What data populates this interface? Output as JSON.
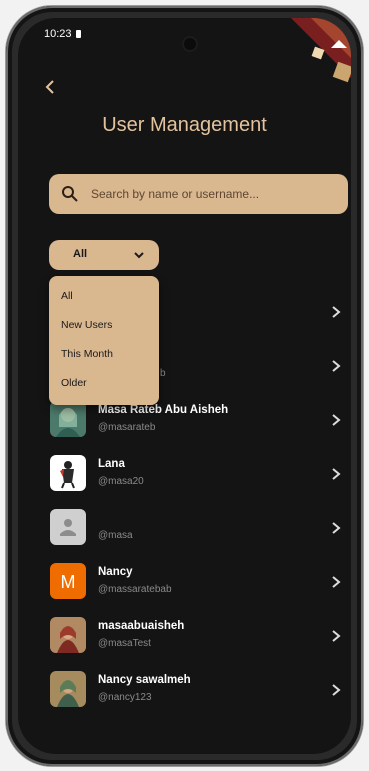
{
  "status_bar": {
    "time": "10:23"
  },
  "header": {
    "title": "User Management"
  },
  "search": {
    "placeholder": "Search by name or username..."
  },
  "filter": {
    "selected": "All",
    "options": [
      "All",
      "New Users",
      "This Month",
      "Older"
    ]
  },
  "users": [
    {
      "name": "",
      "handle": "",
      "avatar": "hidden"
    },
    {
      "name": "",
      "handle": "@masaratebab",
      "handle_visible": "b",
      "avatar": "hidden"
    },
    {
      "name": "Masa Rateb Abu Aisheh",
      "handle": "@masarateb",
      "avatar": "photo-green"
    },
    {
      "name": "Lana",
      "handle": "@masa20",
      "avatar": "photo-figure"
    },
    {
      "name": "",
      "handle": "@masa",
      "avatar": "placeholder"
    },
    {
      "name": "Nancy",
      "handle": "@massaratebab",
      "avatar": "letter-M"
    },
    {
      "name": "masaabuaisheh",
      "handle": "@masaTest",
      "avatar": "photo-red"
    },
    {
      "name": "Nancy sawalmeh",
      "handle": "@nancy123",
      "avatar": "photo-green"
    }
  ],
  "colors": {
    "accent": "#d9b78f",
    "title": "#e3c39d",
    "background": "#141414"
  }
}
